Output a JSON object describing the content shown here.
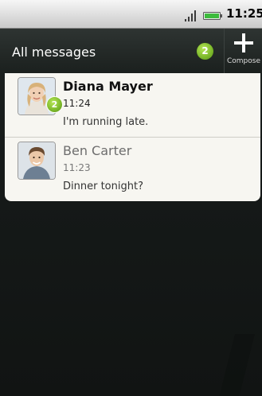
{
  "status_bar": {
    "time": "11:25",
    "icons": [
      "signal-icon",
      "battery-icon"
    ]
  },
  "header": {
    "title": "All messages",
    "unread_count": "2",
    "compose_label": "Compose",
    "compose_icon": "plus-icon"
  },
  "messages": [
    {
      "name": "Diana Mayer",
      "time": "11:24",
      "preview": "I'm running late.",
      "unread_badge": "2",
      "is_unread": true
    },
    {
      "name": "Ben Carter",
      "time": "11:23",
      "preview": "Dinner tonight?",
      "is_unread": false
    }
  ],
  "colors": {
    "badge_green": "#7bb82a",
    "panel_bg": "#f7f6f1",
    "header_bg": "#1b201e"
  }
}
